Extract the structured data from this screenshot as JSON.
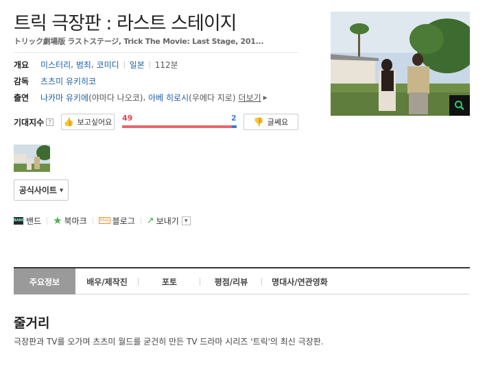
{
  "movie": {
    "title": "트릭 극장판 : 라스트 스테이지",
    "subtitle": "トリック劇場版 ラストステージ, Trick The Movie: Last Stage, 201..."
  },
  "info": {
    "overview_label": "개요",
    "genres": [
      "미스터리",
      "범죄",
      "코미디"
    ],
    "country": "일본",
    "runtime": "112분",
    "director_label": "감독",
    "director": "츠츠미 유키히코",
    "cast_label": "출연",
    "cast": [
      {
        "name": "나카마 유키에",
        "role": "(야마다 나오코)"
      },
      {
        "name": "아베 히로시",
        "role": "(우에다 지로)"
      }
    ],
    "more_label": "더보기"
  },
  "expectation": {
    "label": "기대지수",
    "help_icon": "?",
    "want_label": "보고싶어요",
    "want_count": "49",
    "meh_label": "글쎄요",
    "meh_count": "2",
    "want_ratio": 0.96
  },
  "official_site_label": "공식사이트",
  "share": {
    "band": "밴드",
    "bookmark": "북마크",
    "blog": "블로그",
    "send": "보내기"
  },
  "tabs": [
    "주요정보",
    "배우/제작진",
    "포토",
    "평점/리뷰",
    "명대사/연관영화"
  ],
  "synopsis": {
    "heading": "줄거리",
    "text": "극장판과 TV를 오가며 츠츠미 월드를 굳건히 만든 TV 드라마 시리즈 '트릭'의 최신 극장판."
  },
  "colors": {
    "link": "#1d5fa8",
    "want": "#e0434a",
    "meh": "#3a7bd5",
    "active_tab": "#9a9a9a"
  },
  "icons": {
    "zoom": "magnifier-icon",
    "want": "thumbs-up-icon",
    "meh": "thumbs-down-icon",
    "bookmark": "star-icon",
    "send": "share-arrow-icon"
  }
}
